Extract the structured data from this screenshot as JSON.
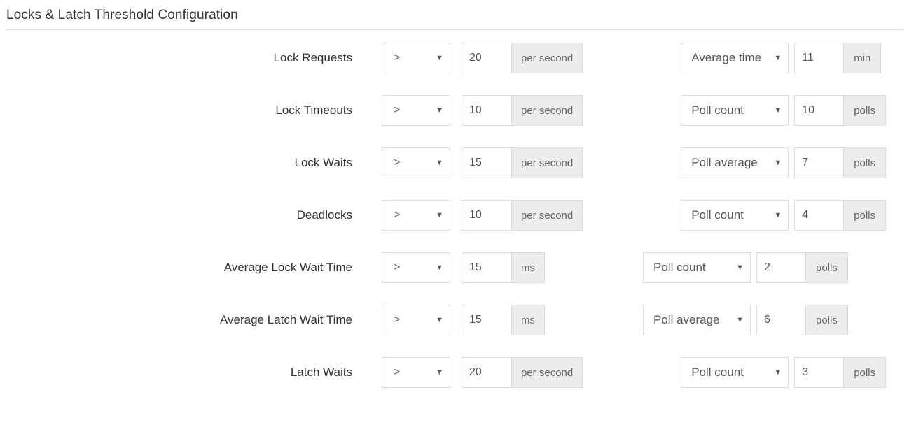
{
  "page": {
    "title": "Locks & Latch Threshold Configuration"
  },
  "icons": {
    "caret_down": "▼"
  },
  "rows": [
    {
      "label": "Lock Requests",
      "operator": ">",
      "value": "20",
      "unit": "per second",
      "duration_type": "Average time",
      "duration_value": "11",
      "duration_unit": "min"
    },
    {
      "label": "Lock Timeouts",
      "operator": ">",
      "value": "10",
      "unit": "per second",
      "duration_type": "Poll count",
      "duration_value": "10",
      "duration_unit": "polls"
    },
    {
      "label": "Lock Waits",
      "operator": ">",
      "value": "15",
      "unit": "per second",
      "duration_type": "Poll average",
      "duration_value": "7",
      "duration_unit": "polls"
    },
    {
      "label": "Deadlocks",
      "operator": ">",
      "value": "10",
      "unit": "per second",
      "duration_type": "Poll count",
      "duration_value": "4",
      "duration_unit": "polls"
    },
    {
      "label": "Average Lock Wait Time",
      "operator": ">",
      "value": "15",
      "unit": "ms",
      "duration_type": "Poll count",
      "duration_value": "2",
      "duration_unit": "polls"
    },
    {
      "label": "Average Latch Wait Time",
      "operator": ">",
      "value": "15",
      "unit": "ms",
      "duration_type": "Poll average",
      "duration_value": "6",
      "duration_unit": "polls"
    },
    {
      "label": "Latch Waits",
      "operator": ">",
      "value": "20",
      "unit": "per second",
      "duration_type": "Poll count",
      "duration_value": "3",
      "duration_unit": "polls"
    }
  ],
  "colors": {
    "text": "#333333",
    "border": "#dcdcdc",
    "suffix_background": "#ededed",
    "divider": "#e3e3e3"
  }
}
